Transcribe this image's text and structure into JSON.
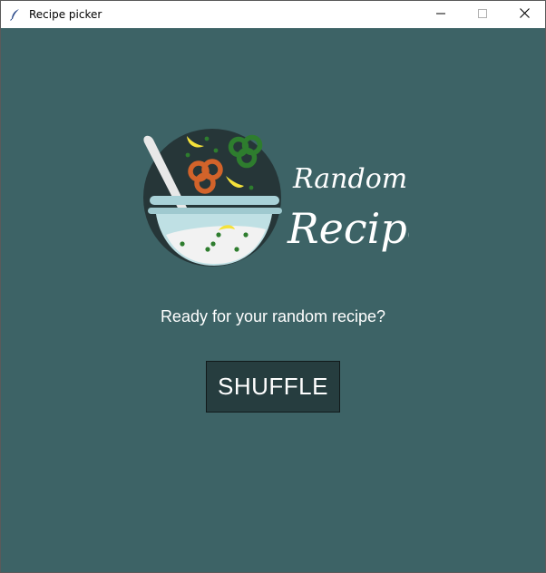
{
  "window": {
    "title": "Recipe picker",
    "icon": "feather-icon",
    "controls": [
      "minimize-icon",
      "maximize-icon",
      "close-icon"
    ]
  },
  "logo": {
    "line1": "Random",
    "line2": "Recipe",
    "icon": "salad-bowl-icon"
  },
  "main": {
    "prompt": "Ready for your random recipe?",
    "shuffle_label": "SHUFFLE"
  },
  "colors": {
    "background": "#3d6366",
    "button_bg": "#263d3f",
    "text": "#ffffff"
  }
}
